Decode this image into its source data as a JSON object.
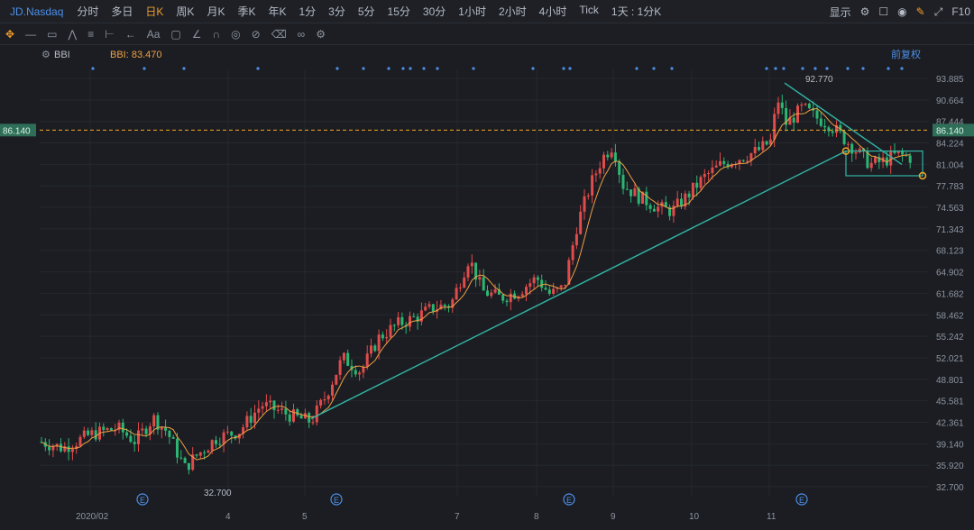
{
  "toolbar": {
    "ticker": "JD.Nasdaq",
    "periods": [
      "分时",
      "多日",
      "日K",
      "周K",
      "月K",
      "季K",
      "年K",
      "1分",
      "3分",
      "5分",
      "15分",
      "30分",
      "1小时",
      "2小时",
      "4小时",
      "Tick",
      "1天 : 1分K"
    ],
    "active_period": "日K",
    "display_label": "显示",
    "right_label": "F10"
  },
  "indicator": {
    "name": "BBI",
    "value_label": "BBI: 83.470",
    "adjust_label": "前复权",
    "colors": {
      "bbi": "#f0a046"
    }
  },
  "colors": {
    "up": "#e04b4b",
    "down": "#2bb673",
    "trendline": "#33b5a5",
    "price_line": "#f5a623",
    "price_tag_bg": "#2f6e58",
    "event_marker": "#4d8fe8",
    "background": "#1b1d22"
  },
  "chart_data": {
    "type": "candlestick",
    "y_ticks": [
      "93.885",
      "90.664",
      "87.444",
      "84.224",
      "81.004",
      "77.783",
      "74.563",
      "71.343",
      "68.123",
      "64.902",
      "61.682",
      "58.462",
      "55.242",
      "52.021",
      "48.801",
      "45.581",
      "42.361",
      "39.140",
      "35.920",
      "32.700"
    ],
    "ylim": [
      32.7,
      93.885
    ],
    "x_ticks": [
      "2020/02",
      "4",
      "5",
      "7",
      "8",
      "9",
      "10",
      "11"
    ],
    "current_price_label": "86.140",
    "current_price": 86.14,
    "high_label": "92.770",
    "low_label": "32.700",
    "event_label": "E",
    "notes": "Daily candles; trendline from ~43 (May) to ~83 (Dec); BBI orange overlay; rectangle consolidation box at right"
  }
}
